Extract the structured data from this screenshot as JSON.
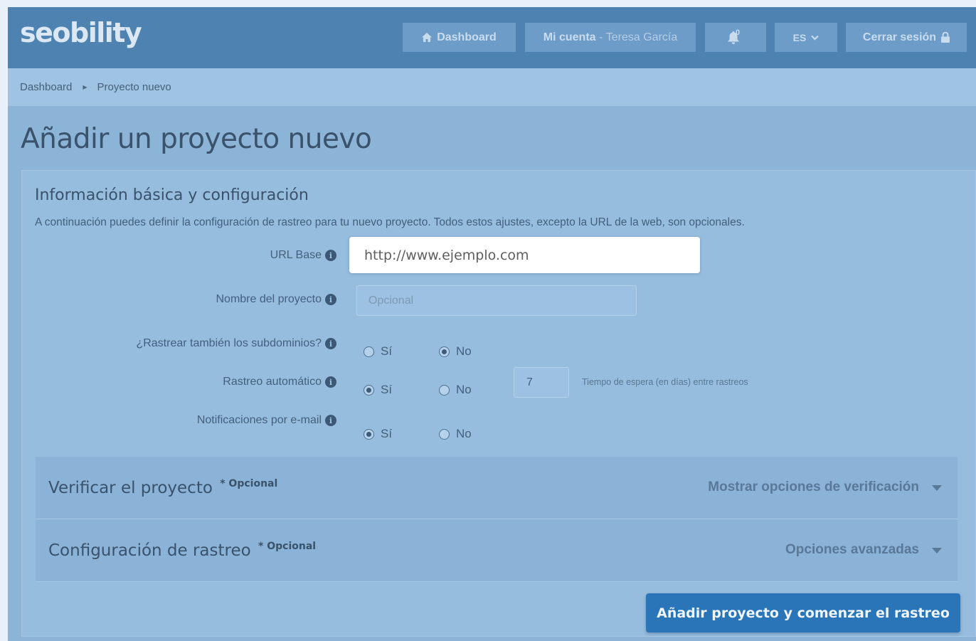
{
  "app": {
    "logo": "seobility"
  },
  "topnav": {
    "dashboard": "Dashboard",
    "account_label": "Mi cuenta",
    "account_separator": " - ",
    "account_user": "Teresa García",
    "notifications_count": "0",
    "language": "ES",
    "logout": "Cerrar sesión"
  },
  "breadcrumb": {
    "home": "Dashboard",
    "current": "Proyecto nuevo"
  },
  "page": {
    "title": "Añadir un proyecto nuevo"
  },
  "panel": {
    "title": "Información básica y configuración",
    "description": "A continuación puedes definir la configuración de rastreo para tu nuevo proyecto. Todos estos ajustes, excepto la URL de la web, son opcionales."
  },
  "form": {
    "url_label": "URL Base",
    "url_placeholder": "http://www.ejemplo.com",
    "url_value": "",
    "name_label": "Nombre del proyecto",
    "name_placeholder": "Opcional",
    "name_value": "",
    "subdomains_label": "¿Rastrear también los subdominios?",
    "subdomains_selected": "No",
    "auto_crawl_label": "Rastreo automático",
    "auto_crawl_selected": "Sí",
    "crawl_days_value": "7",
    "crawl_days_hint": "Tiempo de espera (en días) entre rastreos",
    "email_label": "Notificaciones por e-mail",
    "email_selected": "Sí",
    "yes": "Sí",
    "no": "No",
    "info_glyph": "i"
  },
  "sections": {
    "verify_title": "Verificar el proyecto",
    "verify_optional": "* Opcional",
    "verify_toggle": "Mostrar opciones de verificación",
    "crawl_title": "Configuración de rastreo",
    "crawl_optional": "* Opcional",
    "crawl_toggle": "Opciones avanzadas"
  },
  "actions": {
    "submit": "Añadir proyecto y comenzar el rastreo"
  },
  "colors": {
    "topbar": "#4d82b1",
    "page_bg": "#8cb4d6",
    "accent_button": "#2a74b8"
  },
  "icons": {
    "dashboard": "home-icon",
    "notifications": "bell-icon",
    "language_dropdown": "chevron-down-icon",
    "logout": "lock-icon",
    "info": "info-icon",
    "section_toggle": "caret-down-icon"
  }
}
